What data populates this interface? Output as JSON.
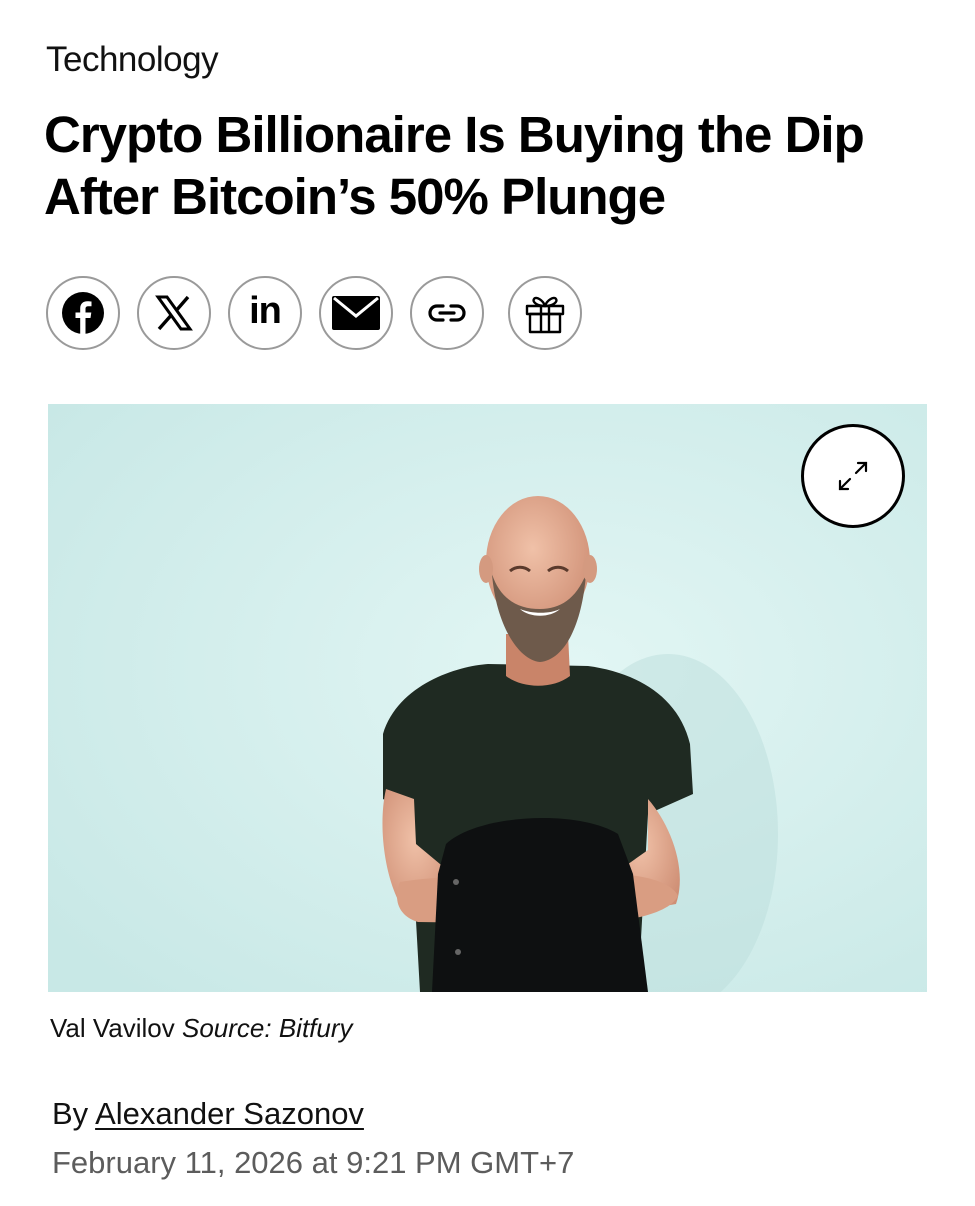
{
  "article": {
    "section": "Technology",
    "headline": "Crypto Billionaire Is Buying the Dip After Bitcoin’s 50% Plunge"
  },
  "share": {
    "buttons": [
      {
        "icon": "facebook-icon"
      },
      {
        "icon": "x-icon"
      },
      {
        "icon": "linkedin-icon",
        "glyph": "in"
      },
      {
        "icon": "mail-icon"
      },
      {
        "icon": "link-icon"
      },
      {
        "icon": "gift-icon"
      }
    ]
  },
  "image": {
    "subject": "Val Vavilov",
    "credit": "Source: Bitfury",
    "background_color": "#d6f0ee",
    "expand_icon": "expand-arrows-icon"
  },
  "byline": {
    "prefix": "By",
    "author": "Alexander Sazonov",
    "date": "February 11, 2026 at 9:21 PM GMT+7"
  }
}
